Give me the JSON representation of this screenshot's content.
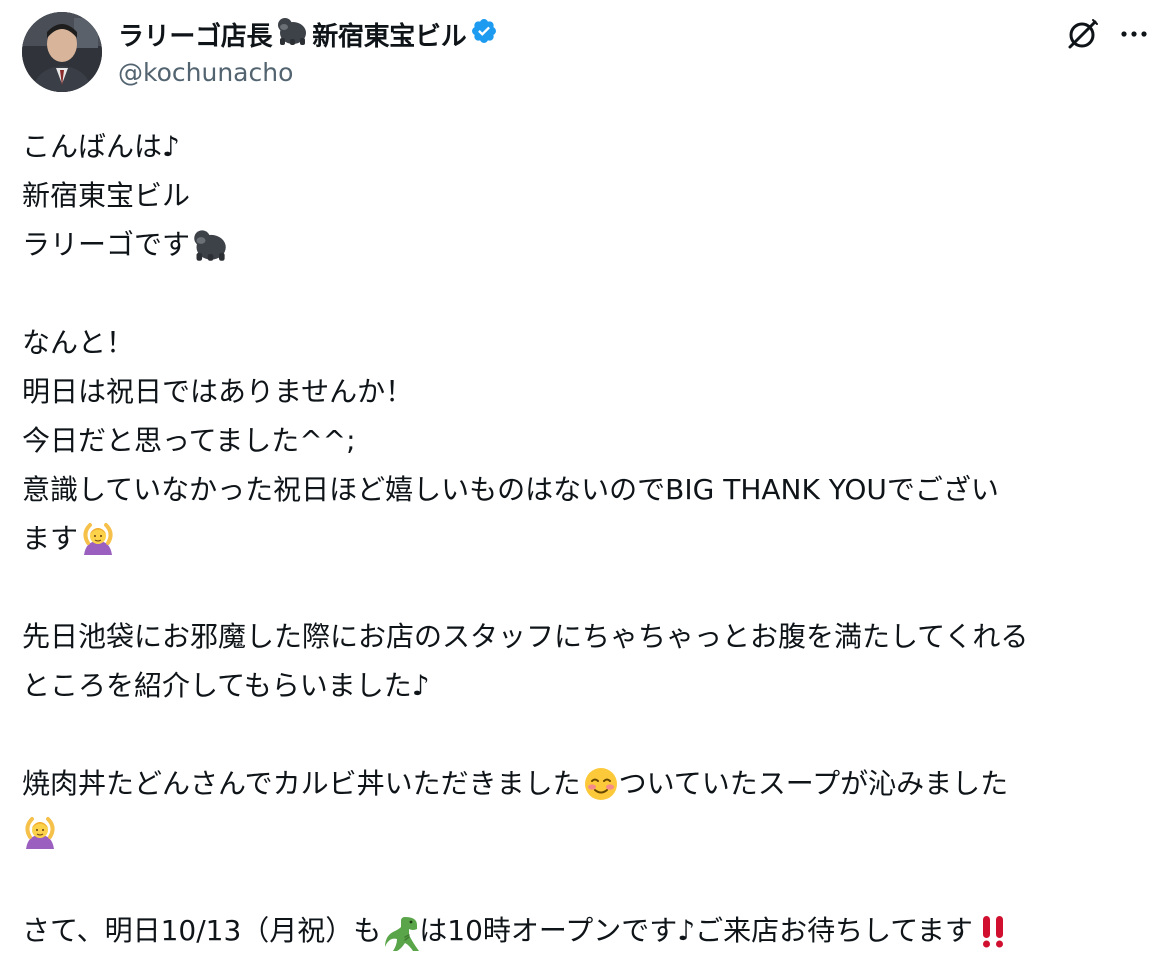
{
  "author": {
    "display_name": "ラリーゴ店長",
    "display_name_suffix": "新宿東宝ビル",
    "handle": "@kochunacho",
    "verified": true,
    "verified_color": "#1d9bf0"
  },
  "actions": {
    "grok_icon": "grok-icon",
    "more_icon": "more-icon"
  },
  "tweet": {
    "lines": [
      "こんばんは♪",
      "新宿東宝ビル",
      "ラリーゴです",
      "",
      "なんと！",
      "明日は祝日ではありませんか！",
      "今日だと思ってました^^;",
      "意識していなかった祝日ほど嬉しいものはないのでBIG THANK YOUでござい",
      "ます",
      "",
      "先日池袋にお邪魔した際にお店のスタッフにちゃちゃっとお腹を満たしてくれる",
      "ところを紹介してもらいました♪",
      "",
      "焼肉丼たどんさんでカルビ丼いただきました",
      "ついていたスープが沁みました",
      "",
      "",
      "さて、明日10/13（月祝）も",
      "は10時オープンです♪ご来店お待ちしてます"
    ]
  },
  "colors": {
    "text": "#0f1419",
    "secondary": "#536471",
    "accent_red": "#d0102e"
  },
  "emoji": {
    "gorilla": "gorilla-emoji",
    "ok_gesture": "person-gesturing-ok-emoji",
    "blushing": "smiling-face-emoji",
    "dinosaur": "t-rex-emoji",
    "double_exclamation": "double-exclamation-emoji"
  }
}
